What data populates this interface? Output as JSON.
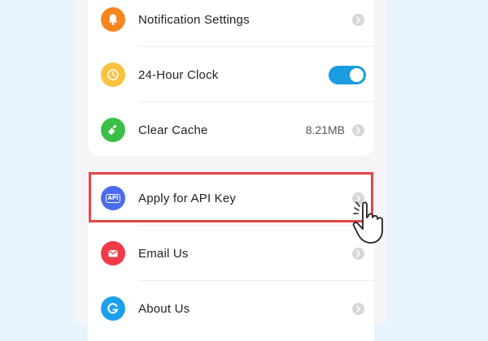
{
  "colors": {
    "background": "#e7f4fc",
    "notification_icon": "#f5861f",
    "clock_icon": "#f7c23e",
    "cache_icon": "#3bbf47",
    "api_icon": "#4a6cf0",
    "email_icon": "#f03a48",
    "about_icon": "#1da0ec",
    "toggle_on": "#1b9be0",
    "highlight_border": "#e84545"
  },
  "settings_group": {
    "items": [
      {
        "label": "Notification Settings",
        "icon": "bell-icon",
        "accessory": "chevron"
      },
      {
        "label": "24-Hour Clock",
        "icon": "clock-icon",
        "accessory": "toggle",
        "toggle_on": true
      },
      {
        "label": "Clear Cache",
        "icon": "broom-icon",
        "accessory": "chevron",
        "value": "8.21MB"
      }
    ]
  },
  "support_group": {
    "items": [
      {
        "label": "Apply for API Key",
        "icon": "api-icon",
        "icon_text": "API",
        "accessory": "chevron",
        "highlighted": true
      },
      {
        "label": "Email Us",
        "icon": "mail-icon",
        "accessory": "chevron"
      },
      {
        "label": "About Us",
        "icon": "app-logo-icon",
        "accessory": "chevron"
      }
    ]
  },
  "overlay": {
    "pointer_icon": "tap-hand-icon"
  }
}
